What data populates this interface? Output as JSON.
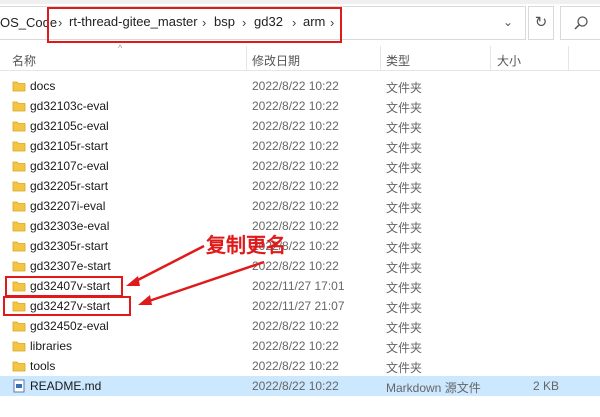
{
  "address": {
    "root": "OS_Code",
    "crumbs": [
      "rt-thread-gitee_master",
      "bsp",
      "gd32",
      "arm"
    ],
    "separator": "›"
  },
  "columns": {
    "name": "名称",
    "date": "修改日期",
    "type": "类型",
    "size": "大小"
  },
  "files": [
    {
      "name": "docs",
      "date": "2022/8/22 10:22",
      "type": "文件夹",
      "size": "",
      "kind": "folder"
    },
    {
      "name": "gd32103c-eval",
      "date": "2022/8/22 10:22",
      "type": "文件夹",
      "size": "",
      "kind": "folder"
    },
    {
      "name": "gd32105c-eval",
      "date": "2022/8/22 10:22",
      "type": "文件夹",
      "size": "",
      "kind": "folder"
    },
    {
      "name": "gd32105r-start",
      "date": "2022/8/22 10:22",
      "type": "文件夹",
      "size": "",
      "kind": "folder"
    },
    {
      "name": "gd32107c-eval",
      "date": "2022/8/22 10:22",
      "type": "文件夹",
      "size": "",
      "kind": "folder"
    },
    {
      "name": "gd32205r-start",
      "date": "2022/8/22 10:22",
      "type": "文件夹",
      "size": "",
      "kind": "folder"
    },
    {
      "name": "gd32207i-eval",
      "date": "2022/8/22 10:22",
      "type": "文件夹",
      "size": "",
      "kind": "folder"
    },
    {
      "name": "gd32303e-eval",
      "date": "2022/8/22 10:22",
      "type": "文件夹",
      "size": "",
      "kind": "folder"
    },
    {
      "name": "gd32305r-start",
      "date": "2022/8/22 10:22",
      "type": "文件夹",
      "size": "",
      "kind": "folder"
    },
    {
      "name": "gd32307e-start",
      "date": "2022/8/22 10:22",
      "type": "文件夹",
      "size": "",
      "kind": "folder"
    },
    {
      "name": "gd32407v-start",
      "date": "2022/11/27 17:01",
      "type": "文件夹",
      "size": "",
      "kind": "folder"
    },
    {
      "name": "gd32427v-start",
      "date": "2022/11/27 21:07",
      "type": "文件夹",
      "size": "",
      "kind": "folder"
    },
    {
      "name": "gd32450z-eval",
      "date": "2022/8/22 10:22",
      "type": "文件夹",
      "size": "",
      "kind": "folder"
    },
    {
      "name": "libraries",
      "date": "2022/8/22 10:22",
      "type": "文件夹",
      "size": "",
      "kind": "folder"
    },
    {
      "name": "tools",
      "date": "2022/8/22 10:22",
      "type": "文件夹",
      "size": "",
      "kind": "folder"
    },
    {
      "name": "README.md",
      "date": "2022/8/22 10:22",
      "type": "Markdown 源文件",
      "size": "2 KB",
      "kind": "file",
      "selected": true
    }
  ],
  "annotation": {
    "text": "复制更名",
    "color": "#e01a1a"
  },
  "colors": {
    "folder": "#f4c542",
    "selection": "#cce8ff",
    "highlight": "#e01a1a"
  },
  "icons": {
    "refresh": "↻",
    "dropdown": "⌄",
    "sort": "^"
  }
}
